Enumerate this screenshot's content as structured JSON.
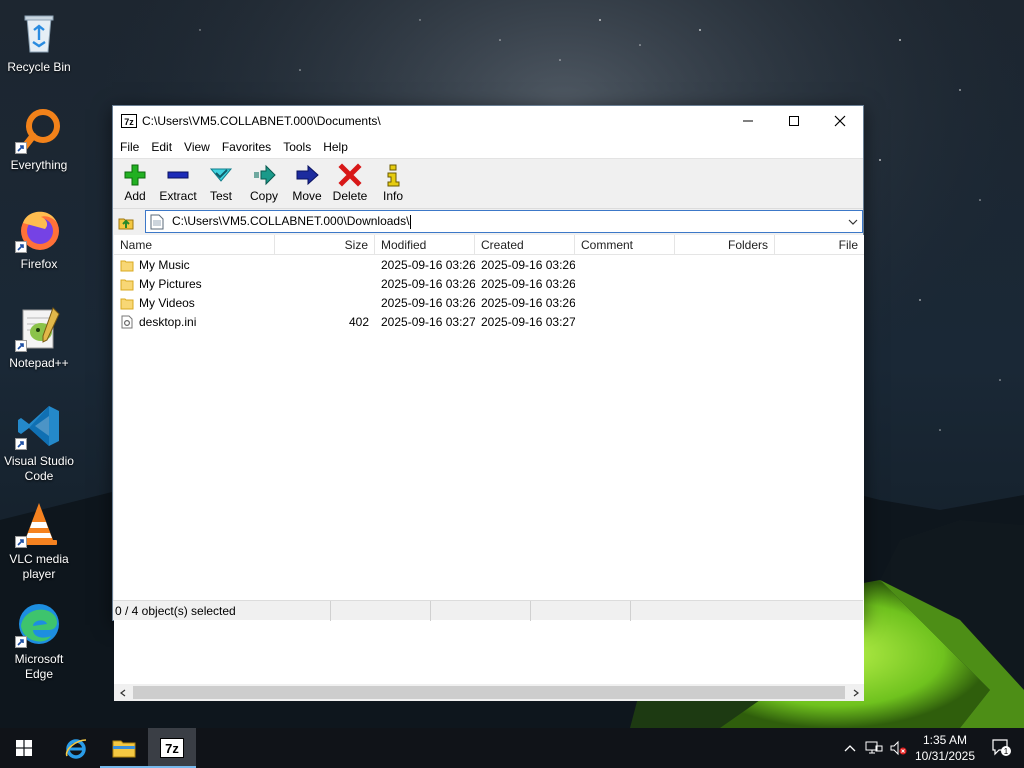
{
  "desktop": {
    "icons": [
      {
        "label": "Recycle Bin",
        "icon": "recycle-bin-icon"
      },
      {
        "label": "Everything",
        "icon": "everything-search-icon"
      },
      {
        "label": "Firefox",
        "icon": "firefox-icon"
      },
      {
        "label": "Notepad++",
        "icon": "notepadpp-icon"
      },
      {
        "label": "Visual Studio Code",
        "icon": "vscode-icon"
      },
      {
        "label": "VLC media player",
        "icon": "vlc-icon"
      },
      {
        "label": "Microsoft Edge",
        "icon": "edge-icon"
      }
    ]
  },
  "window": {
    "title": "C:\\Users\\VM5.COLLABNET.000\\Documents\\",
    "app_icon_text": "7z",
    "menu": [
      "File",
      "Edit",
      "View",
      "Favorites",
      "Tools",
      "Help"
    ],
    "toolbar": [
      {
        "label": "Add",
        "icon": "add-icon",
        "color": "#1aa31a"
      },
      {
        "label": "Extract",
        "icon": "extract-icon",
        "color": "#1c2bb8"
      },
      {
        "label": "Test",
        "icon": "test-icon",
        "color": "#1fb5c4"
      },
      {
        "label": "Copy",
        "icon": "copy-icon",
        "color": "#1b9a8a"
      },
      {
        "label": "Move",
        "icon": "move-icon",
        "color": "#1c2b9e"
      },
      {
        "label": "Delete",
        "icon": "delete-icon",
        "color": "#d81818"
      },
      {
        "label": "Info",
        "icon": "info-icon",
        "color": "#d8c000"
      }
    ],
    "address_value": "C:\\Users\\VM5.COLLABNET.000\\Downloads\\",
    "columns": [
      "Name",
      "Size",
      "Modified",
      "Created",
      "Comment",
      "Folders",
      "File"
    ],
    "rows": [
      {
        "name": "My Music",
        "type": "folder",
        "size": "",
        "modified": "2025-09-16 03:26",
        "created": "2025-09-16 03:26"
      },
      {
        "name": "My Pictures",
        "type": "folder",
        "size": "",
        "modified": "2025-09-16 03:26",
        "created": "2025-09-16 03:26"
      },
      {
        "name": "My Videos",
        "type": "folder",
        "size": "",
        "modified": "2025-09-16 03:26",
        "created": "2025-09-16 03:26"
      },
      {
        "name": "desktop.ini",
        "type": "file",
        "size": "402",
        "modified": "2025-09-16 03:27",
        "created": "2025-09-16 03:27"
      }
    ],
    "status": "0 / 4 object(s) selected"
  },
  "taskbar": {
    "clock_time": "1:35 AM",
    "clock_date": "10/31/2025",
    "notification_count": "1"
  }
}
